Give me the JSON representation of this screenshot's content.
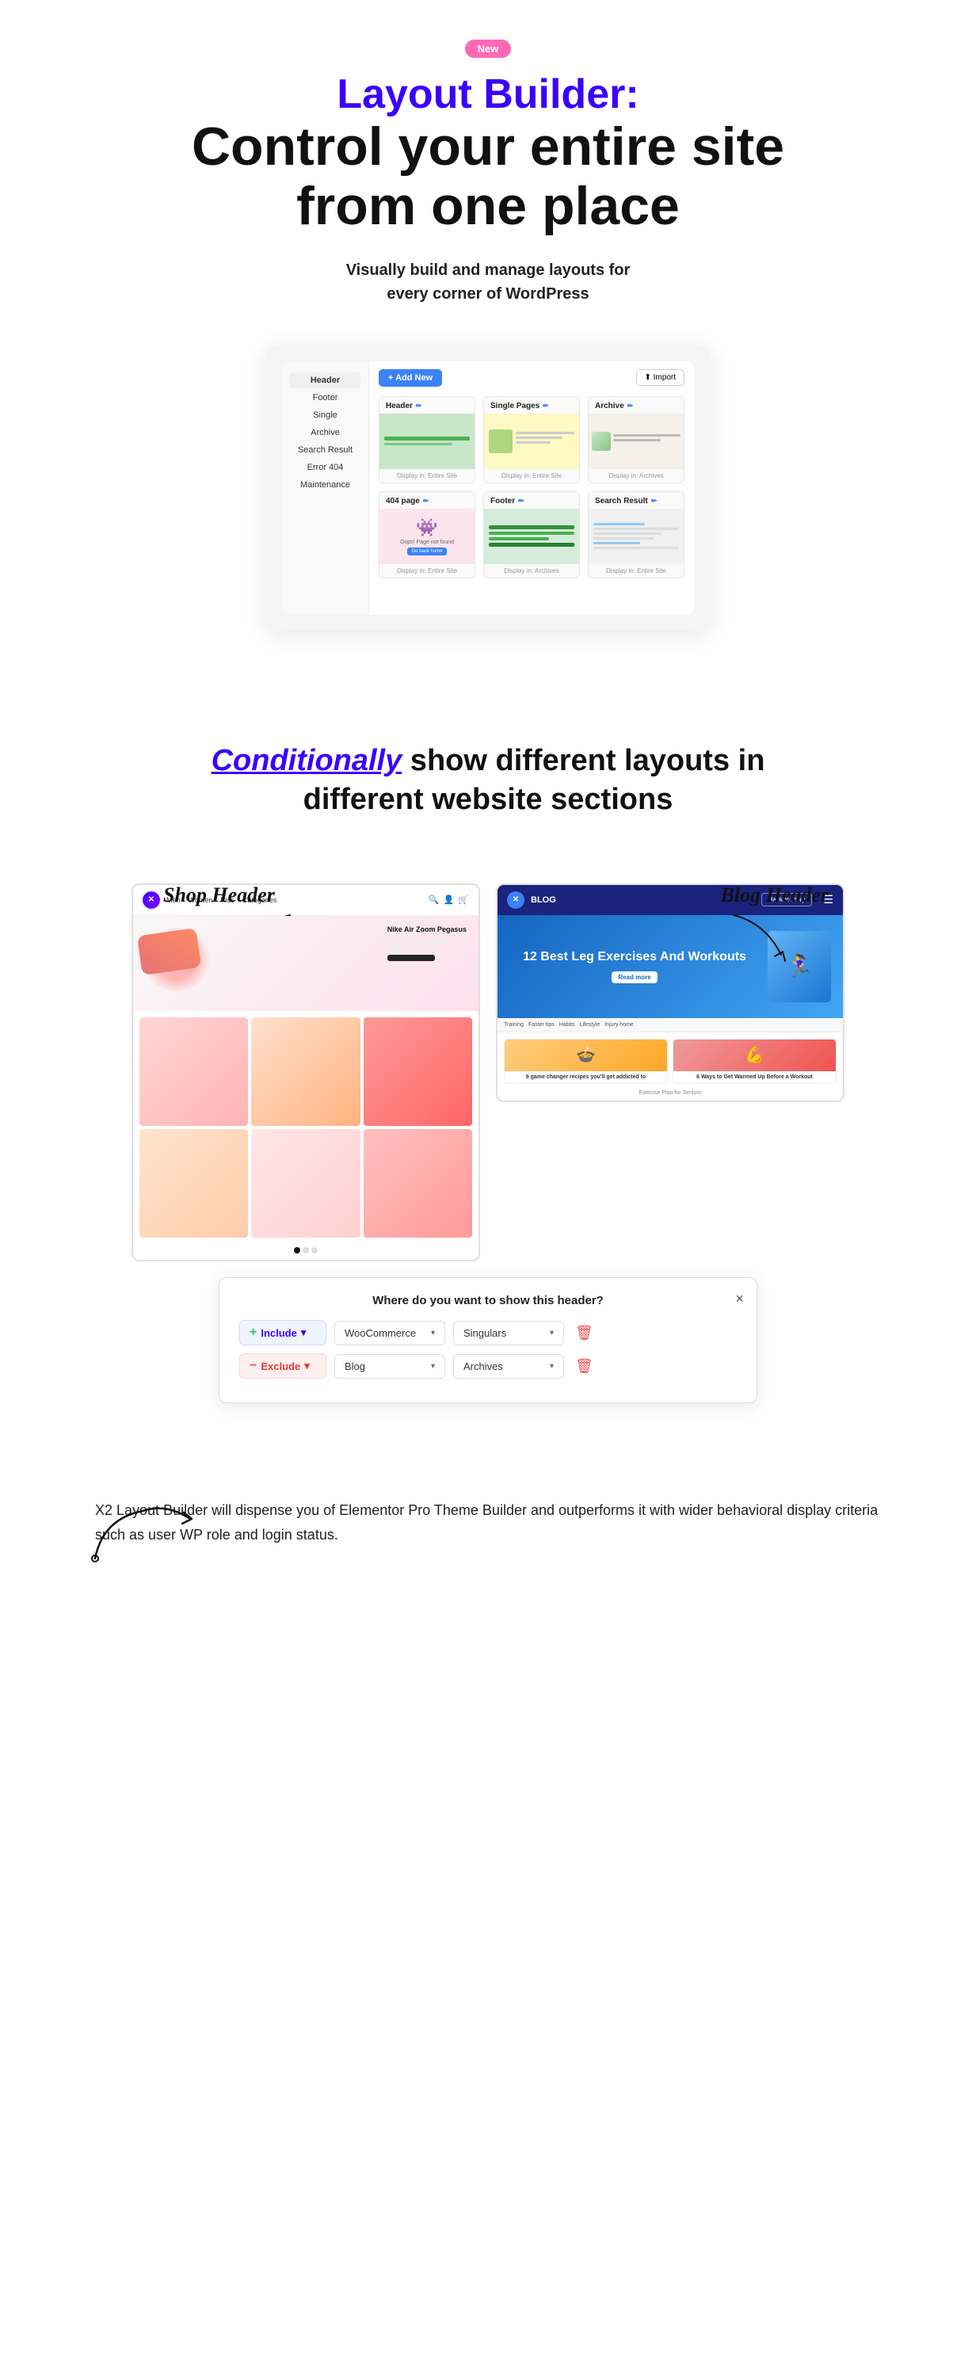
{
  "badge": {
    "label": "New"
  },
  "hero": {
    "title_colored": "Layout Builder:",
    "title_black_line1": "Control your entire site",
    "title_black_line2": "from one place",
    "subtitle_line1": "Visually build and manage layouts for",
    "subtitle_line2": "every corner of WordPress"
  },
  "builder": {
    "add_new_label": "+ Add New",
    "import_label": "⬆ Import",
    "sidebar_items": [
      "Header",
      "Footer",
      "Single",
      "Archive",
      "Search Result",
      "Error 404",
      "Maintenance"
    ],
    "cards": [
      {
        "title": "Header",
        "type": "green"
      },
      {
        "title": "Single Pages",
        "type": "yellow"
      },
      {
        "title": "Archive",
        "type": "beige"
      },
      {
        "title": "404 page",
        "type": "pink"
      },
      {
        "title": "Footer",
        "type": "green2"
      },
      {
        "title": "Search Result",
        "type": "white"
      }
    ],
    "display_label": "Display in: Entire Site",
    "display_archive_label": "Display in: Archives"
  },
  "conditional": {
    "title_part1": "Conditionally",
    "title_part2": " show different layouts in",
    "title_line2": "different website sections"
  },
  "labels": {
    "shop_header": "Shop Header",
    "blog_header": "Blog Header",
    "nike_product": "Nike Air Zoom Pegasus",
    "blog_title": "BLOG",
    "blog_article_title": "12 Best Leg Exercises And Workouts",
    "read_more": "Read more",
    "back_to_story": "Back to story"
  },
  "blog_articles": [
    {
      "title": "9 game changer recipes you'll get addicted to",
      "type": "food"
    },
    {
      "title": "6 Ways to Get Warmed Up Before a Workout",
      "type": "exercise"
    }
  ],
  "blog_nav": [
    "Training",
    "Faster tips",
    "Habits",
    "Lifestyle",
    "Injury home"
  ],
  "dialog": {
    "title": "Where do you want to show this header?",
    "close": "×",
    "rows": [
      {
        "type": "include",
        "type_label": "Include",
        "source": "WooCommerce",
        "scope": "Singulars"
      },
      {
        "type": "exclude",
        "type_label": "Exclude",
        "source": "Blog",
        "scope": "Archives"
      }
    ]
  },
  "description": {
    "text": "X2 Layout Builder will dispense you of Elementor Pro Theme Builder and outperforms it with wider behavioral display criteria such as user WP role and login status."
  },
  "shop_nav": [
    "Men",
    "Women",
    "Kids",
    "Categories"
  ],
  "card_footer_text": "Display in: Entire Site",
  "card_footer_archive": "Display in: Archives"
}
